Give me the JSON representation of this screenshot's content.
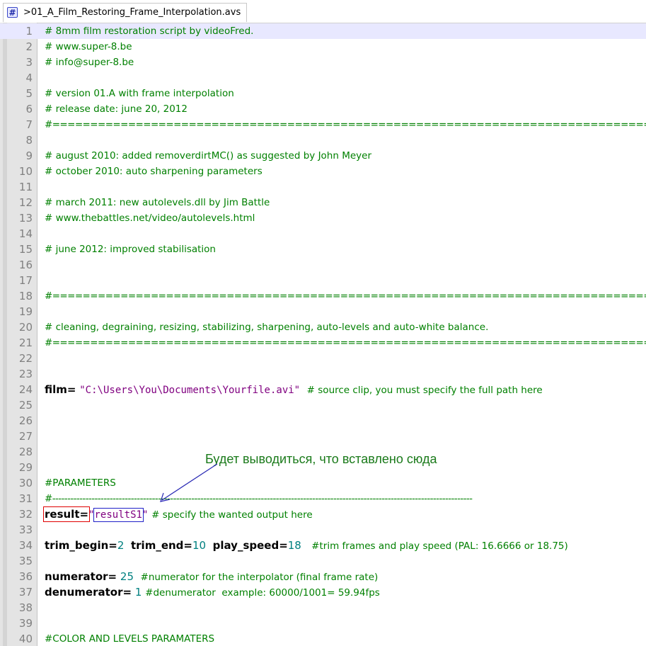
{
  "tab": {
    "title": ">01_A_Film_Restoring_Frame_Interpolation.avs",
    "icon": "hash-script-icon"
  },
  "annotation": {
    "text": "Будет выводиться, что вставлено сюда",
    "color": "#1a7a1a"
  },
  "colors": {
    "comment": "#008000",
    "string": "#800080",
    "number": "#008080",
    "line_number": "#808080",
    "current_line": "#e8e8ff",
    "red_box": "#e00000",
    "blue_box": "#2020c8"
  },
  "lines": [
    {
      "n": "1",
      "current": true,
      "parts": [
        {
          "t": "c",
          "v": "# 8mm film restoration script by videoFred."
        }
      ]
    },
    {
      "n": "2",
      "parts": [
        {
          "t": "c",
          "v": "# www.super-8.be"
        }
      ]
    },
    {
      "n": "3",
      "parts": [
        {
          "t": "c",
          "v": "# info@super-8.be"
        }
      ]
    },
    {
      "n": "4",
      "parts": []
    },
    {
      "n": "5",
      "parts": [
        {
          "t": "c",
          "v": "# version 01.A with frame interpolation"
        }
      ]
    },
    {
      "n": "6",
      "parts": [
        {
          "t": "c",
          "v": "# release date: june 20, 2012"
        }
      ]
    },
    {
      "n": "7",
      "parts": [
        {
          "t": "cm",
          "v": "#==================================================================================================="
        }
      ]
    },
    {
      "n": "8",
      "parts": []
    },
    {
      "n": "9",
      "parts": [
        {
          "t": "c",
          "v": "# august 2010: added removerdirtMC() as suggested by John Meyer"
        }
      ]
    },
    {
      "n": "10",
      "parts": [
        {
          "t": "c",
          "v": "# october 2010: auto sharpening parameters"
        }
      ]
    },
    {
      "n": "11",
      "parts": []
    },
    {
      "n": "12",
      "parts": [
        {
          "t": "c",
          "v": "# march 2011: new autolevels.dll by Jim Battle"
        }
      ]
    },
    {
      "n": "13",
      "parts": [
        {
          "t": "c",
          "v": "# www.thebattles.net/video/autolevels.html"
        }
      ]
    },
    {
      "n": "14",
      "parts": []
    },
    {
      "n": "15",
      "parts": [
        {
          "t": "c",
          "v": "# june 2012: improved stabilisation"
        }
      ]
    },
    {
      "n": "16",
      "parts": []
    },
    {
      "n": "17",
      "parts": []
    },
    {
      "n": "18",
      "parts": [
        {
          "t": "cm",
          "v": "#===================================================================================================="
        }
      ]
    },
    {
      "n": "19",
      "parts": []
    },
    {
      "n": "20",
      "parts": [
        {
          "t": "c",
          "v": "# cleaning, degraining, resizing, stabilizing, sharpening, auto-levels and auto-white balance."
        }
      ]
    },
    {
      "n": "21",
      "parts": [
        {
          "t": "cm",
          "v": "#===================================================================================================="
        }
      ]
    },
    {
      "n": "22",
      "parts": []
    },
    {
      "n": "23",
      "parts": []
    },
    {
      "n": "24",
      "parts": [
        {
          "t": "kw",
          "v": "film="
        },
        {
          "t": "pl",
          "v": " "
        },
        {
          "t": "st",
          "v": "\"C:\\Users\\You\\Documents\\Yourfile.avi\""
        },
        {
          "t": "pl",
          "v": "  "
        },
        {
          "t": "c",
          "v": "# source clip, you must specify the full path here"
        }
      ]
    },
    {
      "n": "25",
      "parts": []
    },
    {
      "n": "26",
      "parts": []
    },
    {
      "n": "27",
      "parts": []
    },
    {
      "n": "28",
      "parts": []
    },
    {
      "n": "29",
      "parts": []
    },
    {
      "n": "30",
      "parts": [
        {
          "t": "c",
          "v": "#PARAMETERS"
        }
      ]
    },
    {
      "n": "31",
      "parts": [
        {
          "t": "cm",
          "v": "#-------------------------------------------------------------------------------------------------------------------------------------------"
        }
      ]
    },
    {
      "n": "32",
      "parts": [
        {
          "t": "kw",
          "v": "result=",
          "box": "red"
        },
        {
          "t": "st",
          "v": "\""
        },
        {
          "t": "st",
          "v": "resultS1",
          "box": "blue"
        },
        {
          "t": "st",
          "v": "\""
        },
        {
          "t": "pl",
          "v": " "
        },
        {
          "t": "c",
          "v": "# specify the wanted output here"
        }
      ]
    },
    {
      "n": "33",
      "parts": []
    },
    {
      "n": "34",
      "parts": [
        {
          "t": "kw",
          "v": "trim_begin="
        },
        {
          "t": "nu",
          "v": "2"
        },
        {
          "t": "pl",
          "v": "  "
        },
        {
          "t": "kw",
          "v": "trim_end="
        },
        {
          "t": "nu",
          "v": "10"
        },
        {
          "t": "pl",
          "v": "  "
        },
        {
          "t": "kw",
          "v": "play_speed="
        },
        {
          "t": "nu",
          "v": "18"
        },
        {
          "t": "pl",
          "v": "   "
        },
        {
          "t": "c",
          "v": "#trim frames and play speed (PAL: 16.6666 or 18.75)"
        }
      ]
    },
    {
      "n": "35",
      "parts": []
    },
    {
      "n": "36",
      "parts": [
        {
          "t": "kw",
          "v": "numerator="
        },
        {
          "t": "pl",
          "v": " "
        },
        {
          "t": "nu",
          "v": "25"
        },
        {
          "t": "pl",
          "v": "  "
        },
        {
          "t": "c",
          "v": "#numerator for the interpolator (final frame rate)"
        }
      ]
    },
    {
      "n": "37",
      "parts": [
        {
          "t": "kw",
          "v": "denumerator="
        },
        {
          "t": "pl",
          "v": " "
        },
        {
          "t": "nu",
          "v": "1"
        },
        {
          "t": "pl",
          "v": " "
        },
        {
          "t": "c",
          "v": "#denumerator  example: 60000/1001= 59.94fps"
        }
      ]
    },
    {
      "n": "38",
      "parts": []
    },
    {
      "n": "39",
      "parts": []
    },
    {
      "n": "40",
      "parts": [
        {
          "t": "c",
          "v": "#COLOR AND LEVELS PARAMATERS"
        }
      ]
    }
  ]
}
